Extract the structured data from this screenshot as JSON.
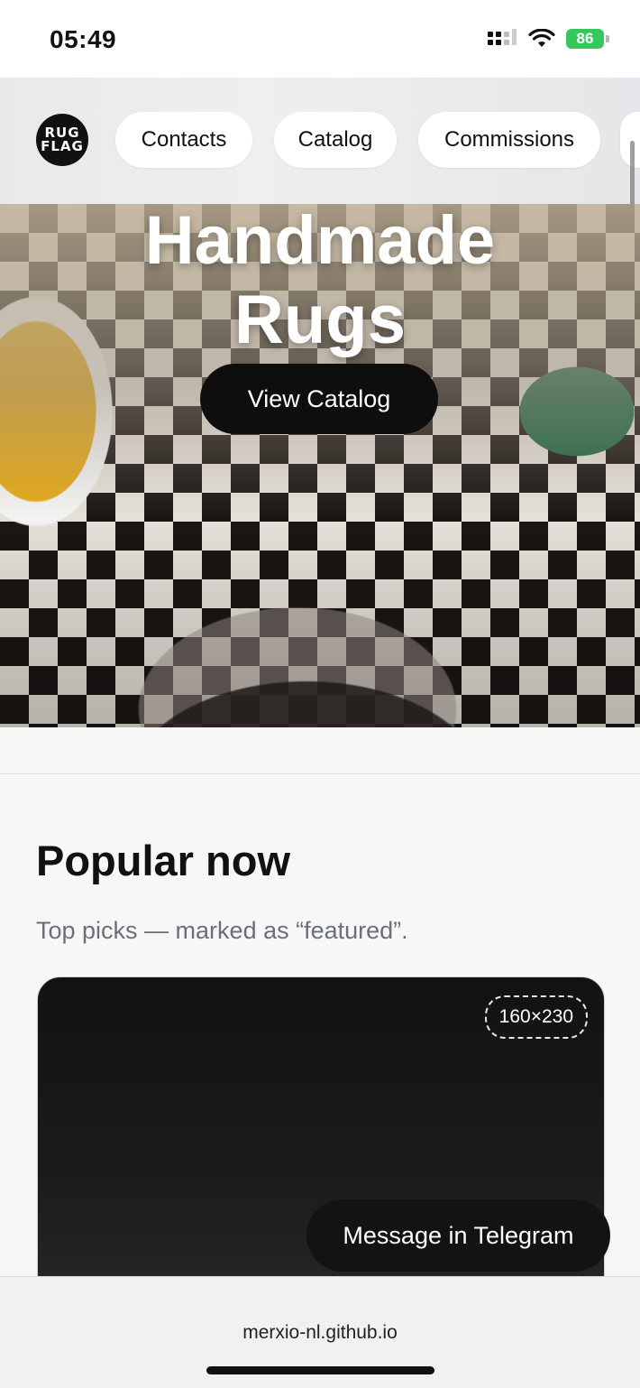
{
  "status_bar": {
    "time": "05:49",
    "battery": "86"
  },
  "header": {
    "logo_lines": [
      "RUG",
      "FLAG"
    ],
    "nav": [
      "Contacts",
      "Catalog",
      "Commissions"
    ]
  },
  "hero": {
    "title_line1": "Handmade",
    "title_line2": "Rugs",
    "cta": "View Catalog"
  },
  "section": {
    "title": "Popular now",
    "subtitle": "Top picks — marked as “featured”."
  },
  "card": {
    "size_badge": "160×230"
  },
  "floating_button": {
    "label": "Message in Telegram"
  },
  "browser": {
    "url": "merxio-nl.github.io"
  },
  "colors": {
    "battery_green": "#34c759",
    "button_dark": "#0e0e0e"
  }
}
